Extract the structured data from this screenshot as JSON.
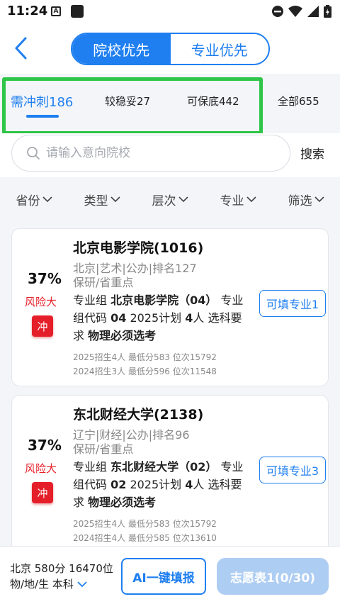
{
  "status": {
    "time": "11:24",
    "a_label": "A"
  },
  "header": {
    "seg_active": "院校优先",
    "seg_inactive": "专业优先"
  },
  "tabs": [
    {
      "label": "需冲刺186"
    },
    {
      "label": "较稳妥27"
    },
    {
      "label": "可保底442"
    },
    {
      "label": "全部655"
    }
  ],
  "search": {
    "placeholder": "请输入意向院校",
    "button": "搜索"
  },
  "filters": [
    {
      "label": "省份"
    },
    {
      "label": "类型"
    },
    {
      "label": "层次"
    },
    {
      "label": "专业"
    },
    {
      "label": "筛选"
    }
  ],
  "cards": [
    {
      "pct": "37%",
      "risk": "风险大",
      "badge": "冲",
      "name": "北京电影学院(1016)",
      "meta1": "北京|艺术|公办|排名127",
      "meta2": "保研/省重点",
      "group_label": "专业组 ",
      "group_name": "北京电影学院（04）",
      "code_label": " 专业组代码 ",
      "code": "04",
      "plan_label": "  2025计划 ",
      "plan": "4",
      "plan_unit": "人  选科要求 ",
      "requirement": "物理必须选考",
      "stat1": "2025招生4人 最低分583 位次15792",
      "stat2": "2024招生3人 最低分596 位次11548",
      "fill_btn": "可填专业1"
    },
    {
      "pct": "37%",
      "risk": "风险大",
      "badge": "冲",
      "name": "东北财经大学(2138)",
      "meta1": "辽宁|财经|公办|排名96",
      "meta2": "保研/省重点",
      "group_label": "专业组 ",
      "group_name": "东北财经大学（02）",
      "code_label": " 专业组代码 ",
      "code": "02",
      "plan_label": "  2025计划 ",
      "plan": "4",
      "plan_unit": "人  选科要求 ",
      "requirement": "物理必须选考",
      "stat1": "2025招生4人 最低分583 位次15792",
      "stat2": "2024招生4人 最低分585 位次13610",
      "fill_btn": "可填专业3"
    }
  ],
  "bottom": {
    "line1": "北京 580分 16470位",
    "line2": "物/地/生 本科",
    "ai_button": "AI一键填报",
    "wish_button": "志愿表1(0/30)"
  },
  "colors": {
    "accent": "#1f7ff0",
    "risk": "#e51f2a",
    "highlight": "#2ec548"
  }
}
